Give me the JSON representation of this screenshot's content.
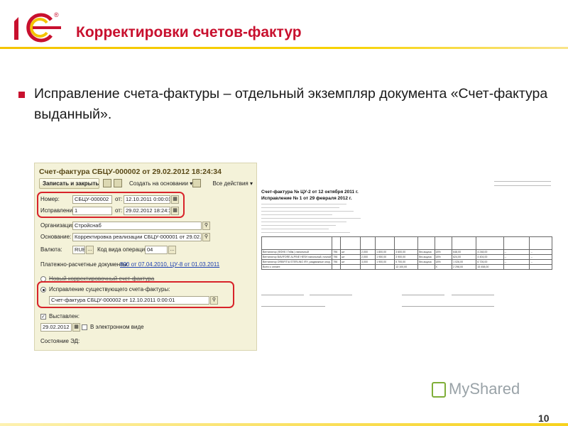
{
  "brand": {
    "logo_text": "1С",
    "reg_mark": "®",
    "logo_color": "#c8102e",
    "accent": "#f4c400"
  },
  "slide": {
    "title": "Корректировки счетов-фактур",
    "bullet": "Исправление счета-фактуры – отдельный экземпляр документа «Счет-фактура выданный».",
    "page_number": "10",
    "watermark": "MyShared"
  },
  "form": {
    "title": "Счет-фактура СБЦУ-000002 от 29.02.2012 18:24:34",
    "toolbar": {
      "save_close": "Записать и закрыть",
      "create_based": "Создать на основании",
      "all_actions": "Все действия"
    },
    "number_label": "Номер:",
    "number_value": "СБЦУ-000002",
    "number_from_label": "от:",
    "number_date": "12.10.2011  0:00:01",
    "correction_label": "Исправление:",
    "correction_value": "1",
    "correction_from_label": "от:",
    "correction_date": "29.02.2012 18:24:34",
    "org_label": "Организация:",
    "org_value": "Стройснаб",
    "basis_label": "Основание:",
    "basis_value": "Корректировка реализации СБЦУ-000001 от 29.02.2012",
    "currency_label": "Валюта:",
    "currency_value": "RUB",
    "op_code_label": "Код вида операции:",
    "op_code_value": "04",
    "payment_label": "Платежно-расчетные документы:",
    "payment_link": "890 от 07.04.2010, ЦУ-8 от 01.03.2011",
    "new_adjust_label": "Новый корректировочный счет-фактура",
    "fix_existing_label": "Исправление существующего счета-фактуры:",
    "fix_existing_value": "Счет-фактура СБЦУ-000002 от 12.10.2011 0:00:01",
    "issued_label": "Выставлен:",
    "issued_date": "29.02.2012",
    "electronic_label": "В электронном виде",
    "ed_state_label": "Состояние ЭД:"
  },
  "document": {
    "header1": "Счет-фактура № ЦУ-2 от 12 октября 2011 г.",
    "header2": "Исправление № 1 от 29 февраля 2012 г.",
    "rows": [
      [
        "Вентилятор (ФОНК / Гейм.) напольный",
        "796",
        "шт",
        "2,000",
        "1 800,00",
        "3 600,00",
        "без акциза",
        "18%",
        "648,00",
        "4 248,00",
        "--",
        "--"
      ],
      [
        "Вентилятор BAVIFORE ALPINE HESH напольный, ночной",
        "796",
        "шт",
        "2,000",
        "1 950,00",
        "3 900,00",
        "без акциза",
        "18%",
        "624,00",
        "4 404,00",
        "--",
        "--"
      ],
      [
        "Вентилятор ORBIFIT/A STERLING /RY, раздвижные опор.",
        "796",
        "шт",
        "3,000",
        "1 900,00",
        "5 700,00",
        "без акциза",
        "18%",
        "1 026,00",
        "6 726,00",
        "--",
        "--"
      ],
      [
        "Всего к оплате",
        "",
        "",
        "",
        "",
        "13 100,00",
        "",
        "X",
        "2 298,00",
        "15 458,00",
        "",
        ""
      ]
    ]
  }
}
